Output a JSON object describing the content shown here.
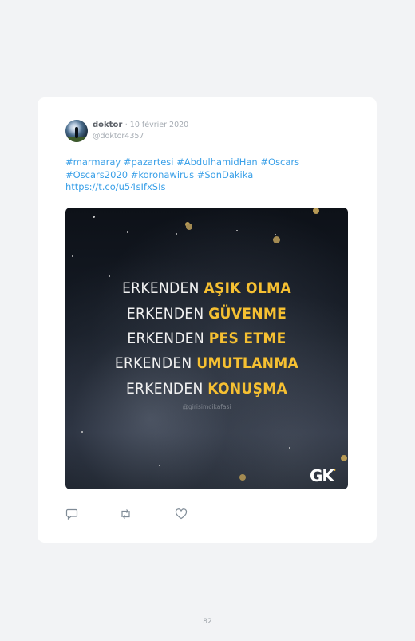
{
  "tweet": {
    "display_name": "doktor",
    "date": "· 10 février 2020",
    "handle": "@doktor4357",
    "text": "#marmaray #pazartesi #AbdulhamidHan #Oscars #Oscars2020 #koronawirus #SonDakika https://t.co/u54sIfxSIs"
  },
  "image": {
    "lines": [
      {
        "white": "ERKENDEN",
        "yellow": "AŞIK OLMA"
      },
      {
        "white": "ERKENDEN",
        "yellow": "GÜVENME"
      },
      {
        "white": "ERKENDEN",
        "yellow": "PES ETME"
      },
      {
        "white": "ERKENDEN",
        "yellow": "UMUTLANMA"
      },
      {
        "white": "ERKENDEN",
        "yellow": "KONUŞMA"
      }
    ],
    "watermark": "@girisimcikafasi",
    "logo": "GK",
    "logo_accent": "'"
  },
  "icons": [
    "reply-icon",
    "retweet-icon",
    "like-icon"
  ],
  "page_number": "82",
  "colors": {
    "link": "#3aa0e8",
    "accent_yellow": "#f6c032"
  }
}
